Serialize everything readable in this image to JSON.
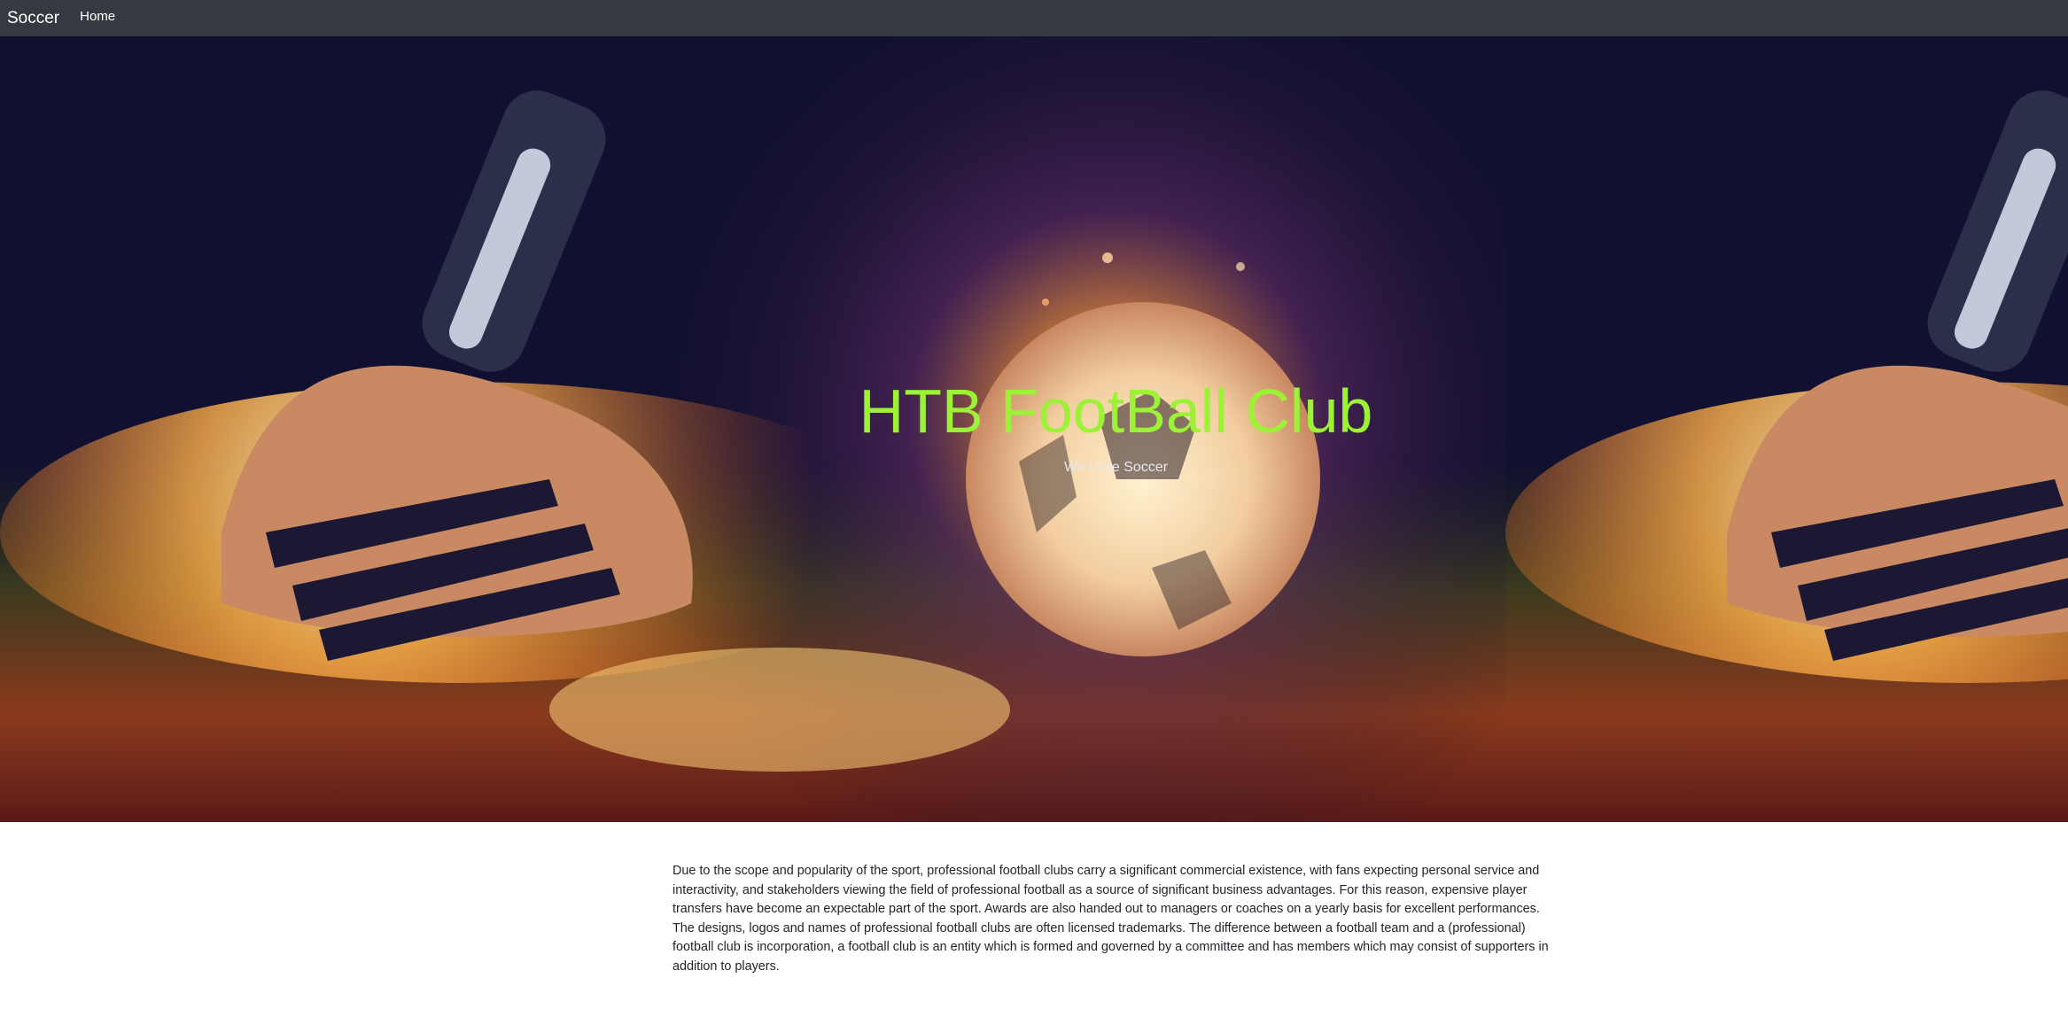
{
  "navbar": {
    "brand": "Soccer",
    "links": [
      "Home"
    ]
  },
  "hero": {
    "title": "HTB FootBall Club",
    "subtitle": "We Love Soccer",
    "title_color": "#9cf235",
    "background_image": "flaming-soccer-ball-kicked-by-cleat"
  },
  "content": {
    "paragraph": "Due to the scope and popularity of the sport, professional football clubs carry a significant commercial existence, with fans expecting personal service and interactivity, and stakeholders viewing the field of professional football as a source of significant business advantages. For this reason, expensive player transfers have become an expectable part of the sport. Awards are also handed out to managers or coaches on a yearly basis for excellent performances. The designs, logos and names of professional football clubs are often licensed trademarks. The difference between a football team and a (professional) football club is incorporation, a football club is an entity which is formed and governed by a committee and has members which may consist of supporters in addition to players."
  },
  "colors": {
    "navbar_bg": "#343a40",
    "nav_text": "#ffffff",
    "body_text": "#212529"
  }
}
